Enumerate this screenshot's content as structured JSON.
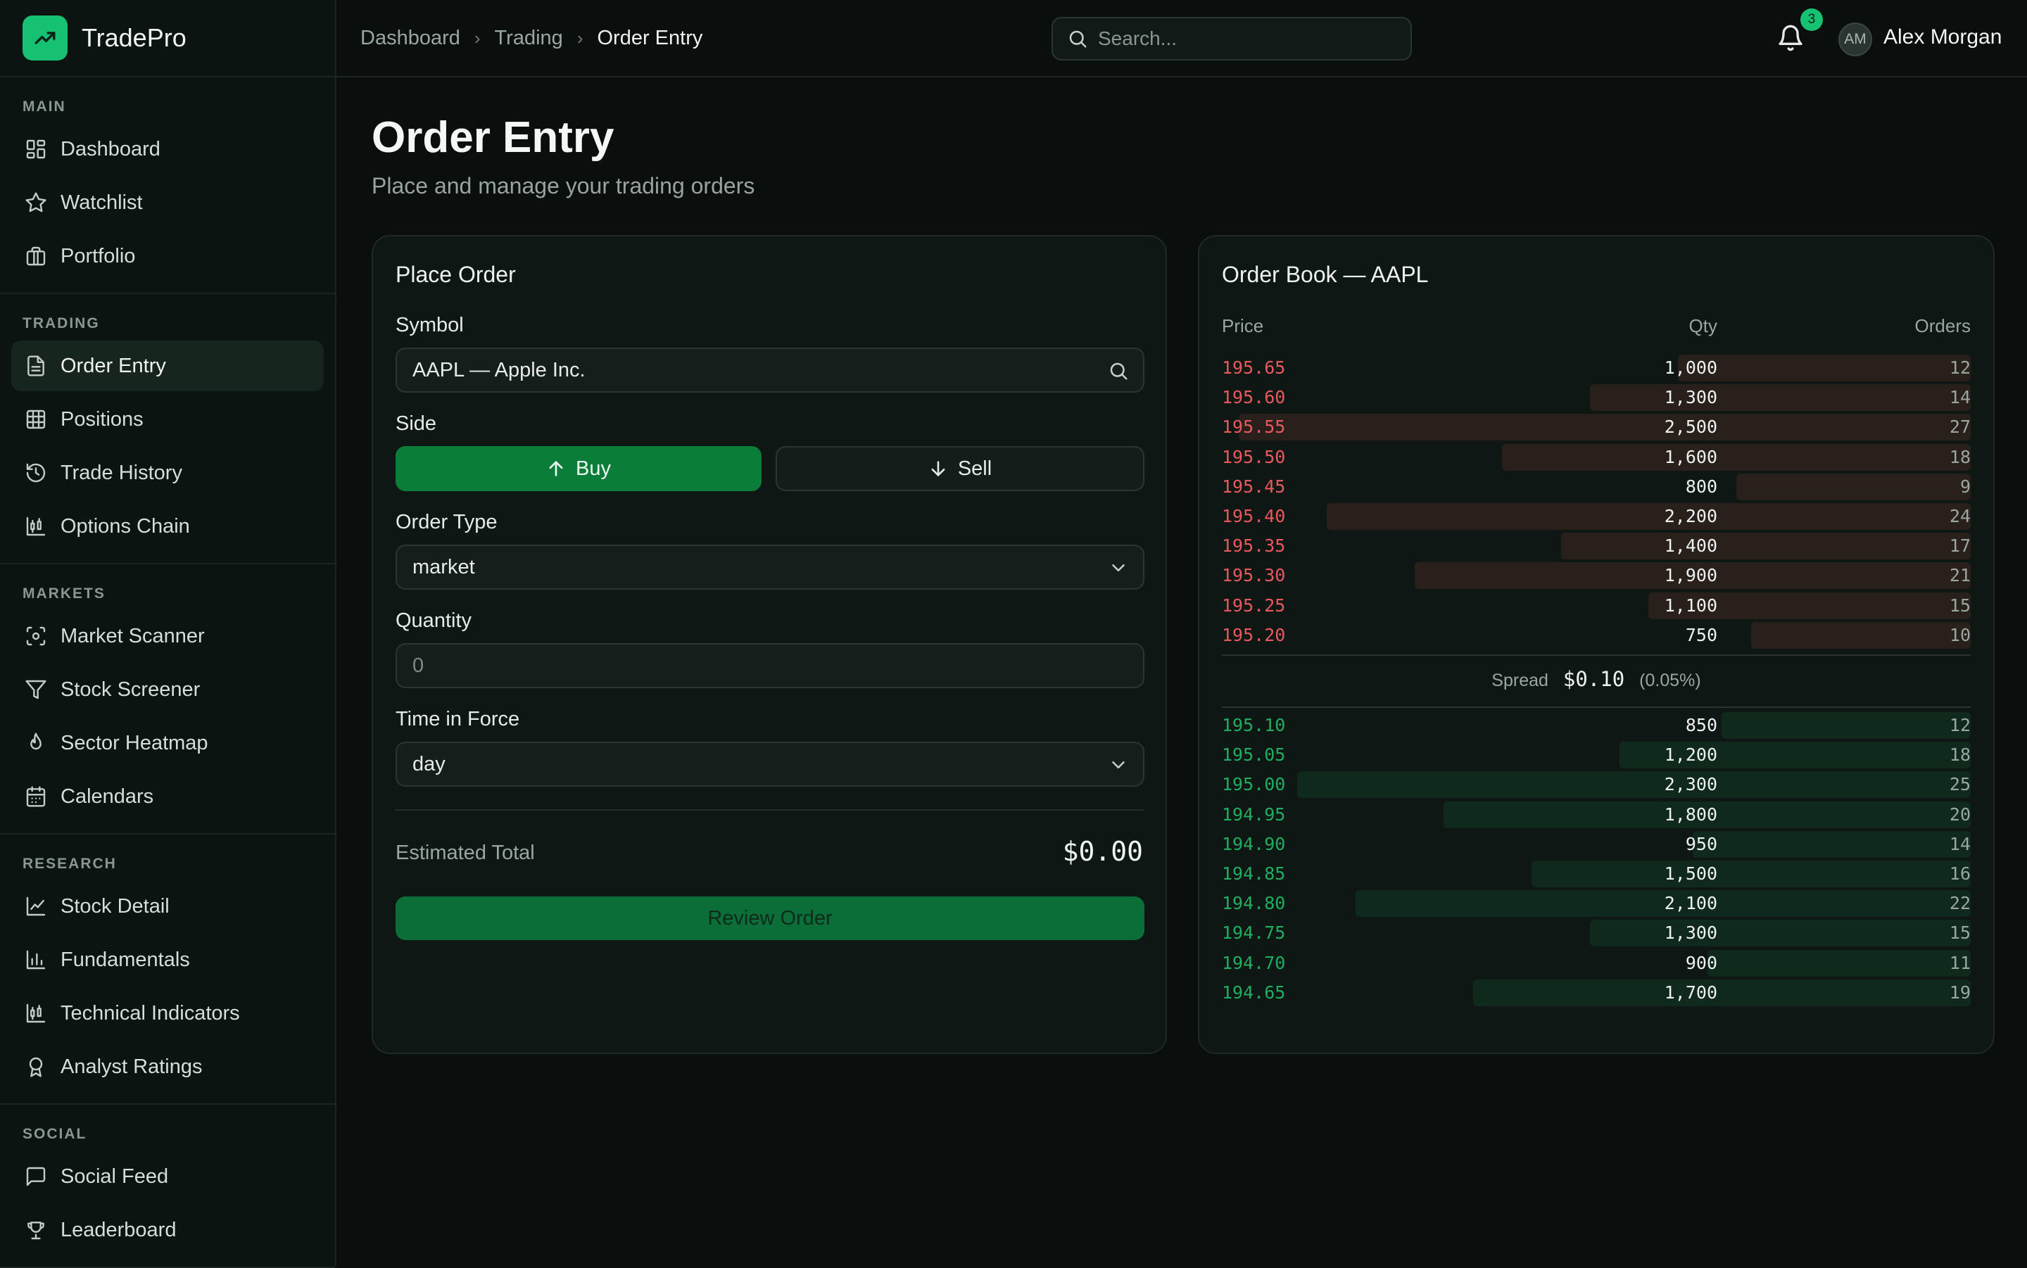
{
  "brand": {
    "name": "TradePro"
  },
  "sidebar": {
    "sections": [
      {
        "title": "MAIN",
        "items": [
          {
            "label": "Dashboard",
            "icon": "dashboard-icon"
          },
          {
            "label": "Watchlist",
            "icon": "star-icon"
          },
          {
            "label": "Portfolio",
            "icon": "briefcase-icon"
          }
        ]
      },
      {
        "title": "TRADING",
        "items": [
          {
            "label": "Order Entry",
            "icon": "document-icon",
            "active": true
          },
          {
            "label": "Positions",
            "icon": "grid-icon"
          },
          {
            "label": "Trade History",
            "icon": "history-icon"
          },
          {
            "label": "Options Chain",
            "icon": "candlestick-icon"
          }
        ]
      },
      {
        "title": "MARKETS",
        "items": [
          {
            "label": "Market Scanner",
            "icon": "scan-icon"
          },
          {
            "label": "Stock Screener",
            "icon": "filter-icon"
          },
          {
            "label": "Sector Heatmap",
            "icon": "flame-icon"
          },
          {
            "label": "Calendars",
            "icon": "calendar-icon"
          }
        ]
      },
      {
        "title": "RESEARCH",
        "items": [
          {
            "label": "Stock Detail",
            "icon": "line-chart-icon"
          },
          {
            "label": "Fundamentals",
            "icon": "bar-chart-icon"
          },
          {
            "label": "Technical Indicators",
            "icon": "candlestick-icon"
          },
          {
            "label": "Analyst Ratings",
            "icon": "award-icon"
          }
        ]
      },
      {
        "title": "SOCIAL",
        "items": [
          {
            "label": "Social Feed",
            "icon": "message-icon"
          },
          {
            "label": "Leaderboard",
            "icon": "trophy-icon"
          }
        ]
      }
    ]
  },
  "header": {
    "breadcrumb": [
      "Dashboard",
      "Trading",
      "Order Entry"
    ],
    "search_placeholder": "Search...",
    "notifications_count": "3",
    "user": {
      "initials": "AM",
      "name": "Alex Morgan"
    }
  },
  "page": {
    "title": "Order Entry",
    "subtitle": "Place and manage your trading orders"
  },
  "order_form": {
    "title": "Place Order",
    "symbol_label": "Symbol",
    "symbol_value": "AAPL — Apple Inc.",
    "side_label": "Side",
    "buy_label": "Buy",
    "sell_label": "Sell",
    "selected_side": "buy",
    "order_type_label": "Order Type",
    "order_type_value": "market",
    "quantity_label": "Quantity",
    "quantity_placeholder": "0",
    "tif_label": "Time in Force",
    "tif_value": "day",
    "estimated_label": "Estimated Total",
    "estimated_value": "$0.00",
    "review_label": "Review Order"
  },
  "order_book": {
    "title": "Order Book — AAPL",
    "headers": {
      "price": "Price",
      "qty": "Qty",
      "orders": "Orders"
    },
    "asks": [
      {
        "price": "195.65",
        "qty": "1,000",
        "orders": "12",
        "size": 1000
      },
      {
        "price": "195.60",
        "qty": "1,300",
        "orders": "14",
        "size": 1300
      },
      {
        "price": "195.55",
        "qty": "2,500",
        "orders": "27",
        "size": 2500
      },
      {
        "price": "195.50",
        "qty": "1,600",
        "orders": "18",
        "size": 1600
      },
      {
        "price": "195.45",
        "qty": "800",
        "orders": "9",
        "size": 800
      },
      {
        "price": "195.40",
        "qty": "2,200",
        "orders": "24",
        "size": 2200
      },
      {
        "price": "195.35",
        "qty": "1,400",
        "orders": "17",
        "size": 1400
      },
      {
        "price": "195.30",
        "qty": "1,900",
        "orders": "21",
        "size": 1900
      },
      {
        "price": "195.25",
        "qty": "1,100",
        "orders": "15",
        "size": 1100
      },
      {
        "price": "195.20",
        "qty": "750",
        "orders": "10",
        "size": 750
      }
    ],
    "spread_label": "Spread",
    "spread_value": "$0.10",
    "spread_pct": "(0.05%)",
    "bids": [
      {
        "price": "195.10",
        "qty": "850",
        "orders": "12",
        "size": 850
      },
      {
        "price": "195.05",
        "qty": "1,200",
        "orders": "18",
        "size": 1200
      },
      {
        "price": "195.00",
        "qty": "2,300",
        "orders": "25",
        "size": 2300
      },
      {
        "price": "194.95",
        "qty": "1,800",
        "orders": "20",
        "size": 1800
      },
      {
        "price": "194.90",
        "qty": "950",
        "orders": "14",
        "size": 950
      },
      {
        "price": "194.85",
        "qty": "1,500",
        "orders": "16",
        "size": 1500
      },
      {
        "price": "194.80",
        "qty": "2,100",
        "orders": "22",
        "size": 2100
      },
      {
        "price": "194.75",
        "qty": "1,300",
        "orders": "15",
        "size": 1300
      },
      {
        "price": "194.70",
        "qty": "900",
        "orders": "11",
        "size": 900
      },
      {
        "price": "194.65",
        "qty": "1,700",
        "orders": "19",
        "size": 1700
      }
    ]
  },
  "colors": {
    "accent": "#16c172",
    "buy": "#0a7d39",
    "ask_text": "#e8585c",
    "bid_text": "#1fae5f"
  }
}
